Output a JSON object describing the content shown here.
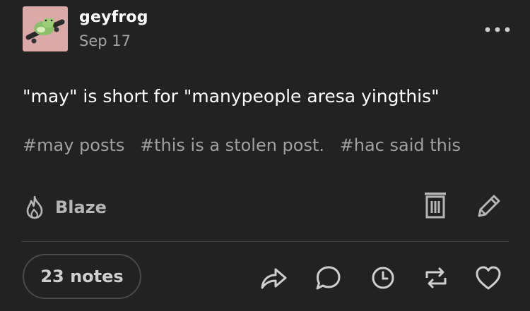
{
  "post": {
    "author": "geyfrog",
    "date": "Sep 17",
    "body": "\"may\" is short for \"manypeople aresa yingthis\"",
    "tags": [
      "#may posts",
      "#this is a stolen post.",
      "#hac said this"
    ]
  },
  "actions": {
    "blaze_label": "Blaze",
    "notes_label": "23 notes"
  },
  "icons": {
    "more": "more-options-icon",
    "flame": "flame-icon",
    "delete": "trash-icon",
    "edit": "pencil-icon",
    "share": "share-icon",
    "reply": "speech-bubble-icon",
    "schedule": "clock-icon",
    "reblog": "reblog-icon",
    "like": "heart-icon"
  },
  "colors": {
    "background": "#222222",
    "text": "#ffffff",
    "muted": "#a3a3a3",
    "avatar_bg": "#dba9a8"
  }
}
